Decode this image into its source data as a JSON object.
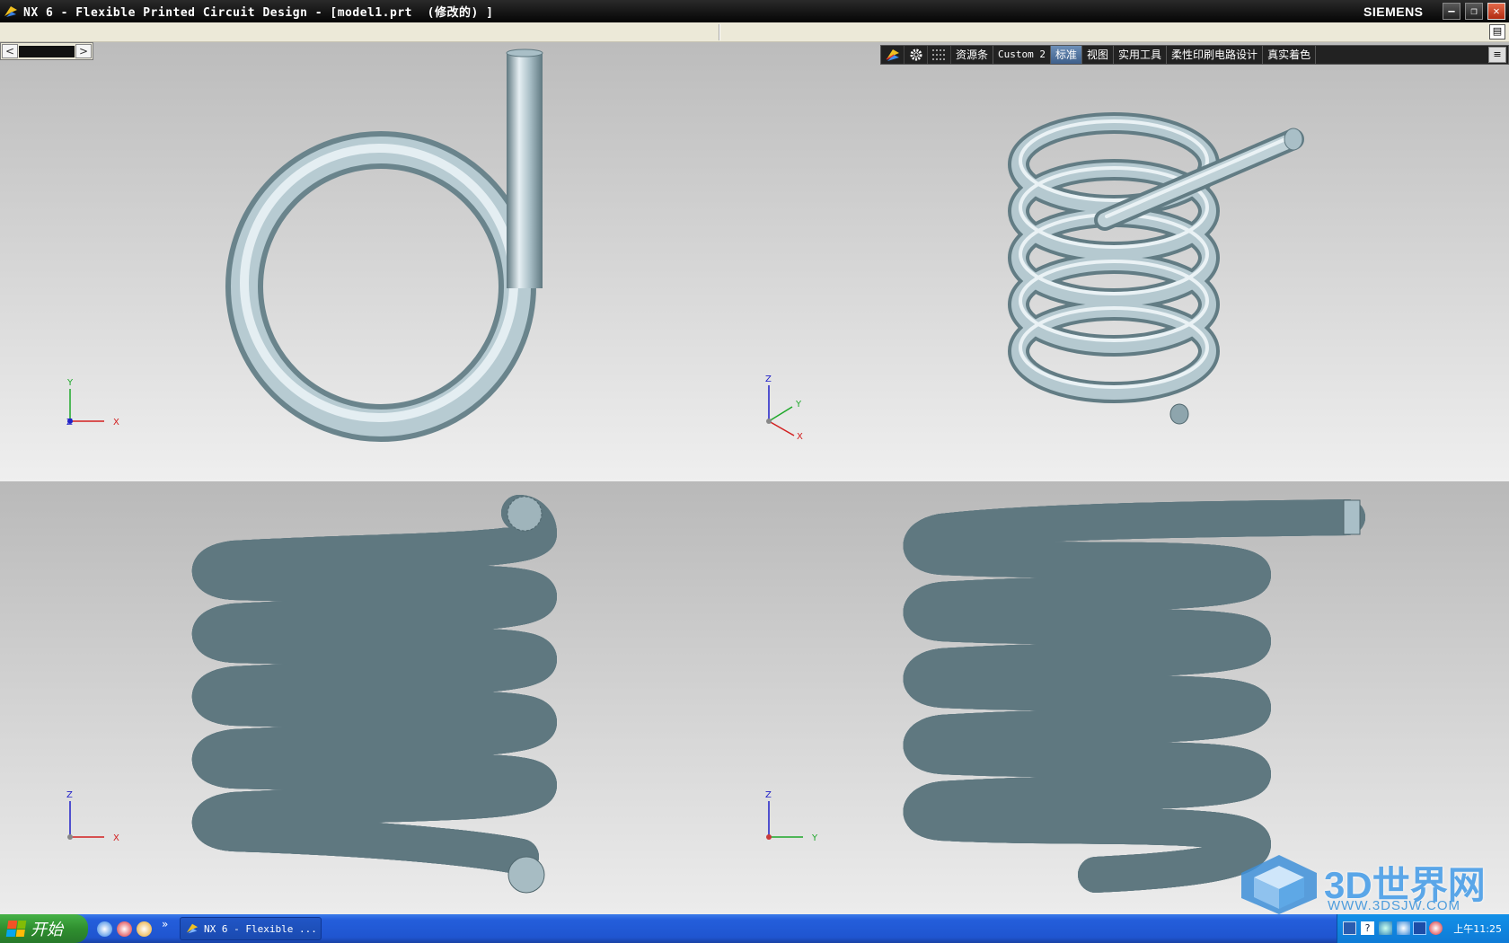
{
  "window": {
    "title": "NX 6 - Flexible Printed Circuit Design - [model1.prt  (修改的) ]",
    "brand": "SIEMENS",
    "controls": {
      "minimize": "–",
      "restore": "❐",
      "close": "✕"
    }
  },
  "viewport_toolbar": {
    "tabs": [
      {
        "label": "资源条",
        "active": false
      },
      {
        "label": "Custom 2",
        "active": false
      },
      {
        "label": "标准",
        "active": true
      },
      {
        "label": "视图",
        "active": false
      },
      {
        "label": "实用工具",
        "active": false
      },
      {
        "label": "柔性印刷电路设计",
        "active": false
      },
      {
        "label": "真实着色",
        "active": false
      }
    ],
    "menu_icon": "≡"
  },
  "scroller": {
    "left": "<",
    "right": ">"
  },
  "views": {
    "top_left": {
      "triad": {
        "axis_1": "Y",
        "axis_2": "X",
        "axis_3": "Z"
      }
    },
    "top_right": {
      "triad": {
        "axis_1": "Z",
        "axis_2": "Y",
        "axis_3": "X"
      }
    },
    "bottom_left": {
      "triad": {
        "axis_1": "Z",
        "axis_2": "X"
      }
    },
    "bottom_right": {
      "triad": {
        "axis_1": "Z",
        "axis_2": "Y"
      }
    }
  },
  "taskbar": {
    "start_label": "开始",
    "more": "»",
    "task_label": "NX 6 - Flexible ...",
    "clock": "上午11:25"
  },
  "watermark": {
    "text": "3D世界网",
    "url": "WWW.3DSJW.COM"
  },
  "colors": {
    "spring_light": "#e6eff3",
    "spring_mid": "#a9bfc7",
    "spring_dark": "#5f7880",
    "axis_x": "#d22020",
    "axis_y": "#1ea82a",
    "axis_z": "#2020c8"
  }
}
